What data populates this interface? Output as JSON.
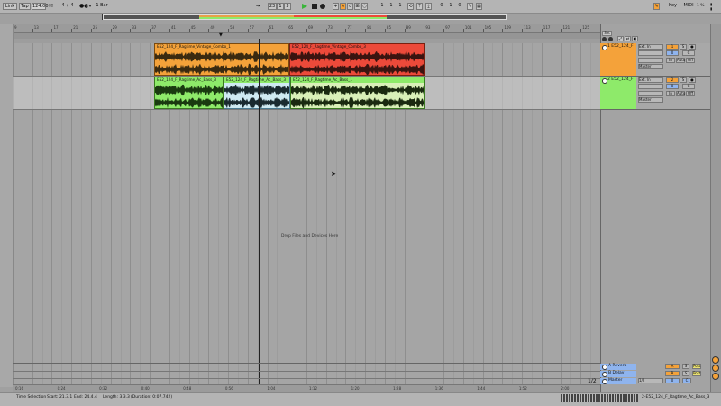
{
  "colors": {
    "track1": "#f4a23a",
    "track1_clip2": "#ec4a3a",
    "track2": "#8eea6a",
    "track2_sel": "#cfeaf2",
    "return_blue": "#8fb4ee",
    "arrangement_bg": "#a5a5a5",
    "transport_bg": "#b4b4b4"
  },
  "transport": {
    "link": "Link",
    "tap": "Tap",
    "tempo": "124.00",
    "sig_num": "4",
    "sig_den": "4",
    "metro": "1 Bar",
    "position": [
      "23",
      "1",
      "3"
    ],
    "loop_start": [
      "1",
      "1",
      "1"
    ],
    "loop_len": [
      "0",
      "1",
      "0"
    ],
    "key": "Key",
    "midi": "MIDI",
    "cpu": "1 %"
  },
  "ruler": {
    "bars": [
      "9",
      "13",
      "17",
      "21",
      "25",
      "29",
      "33",
      "37",
      "41",
      "45",
      "49",
      "53",
      "57",
      "61",
      "65",
      "69",
      "73",
      "77",
      "81",
      "85",
      "89",
      "93",
      "97",
      "101",
      "105",
      "109",
      "113",
      "117",
      "121",
      "125"
    ],
    "time_labels": [
      "0:16",
      "0:24",
      "0:32",
      "0:40",
      "0:48",
      "0:56",
      "1:04",
      "1:12",
      "1:20",
      "1:28",
      "1:36",
      "1:44",
      "1:52",
      "2:00"
    ],
    "set_label": "Set"
  },
  "tracks": [
    {
      "name": "1 E52_124_F",
      "input": "Ext. In",
      "output": "Master",
      "number": "1",
      "clips": [
        {
          "title": "E52_124_F_Ragtime_Vintage_Combo_1"
        },
        {
          "title": "E52_124_F_Ragtime_Vintage_Combo_3"
        }
      ]
    },
    {
      "name": "2 E52_124_F",
      "input": "Ext. In",
      "output": "Master",
      "number": "2",
      "clips": [
        {
          "title": "E52_124_F_Ragtime_Ac_Bass_3"
        },
        {
          "title": "E52_124_F_Ragtime_Ac_Bass_3"
        },
        {
          "title": "E52_124_F_Ragtime_Ac_Bass_1"
        }
      ]
    }
  ],
  "drop_text": "Drop Files and Devices Here",
  "returns": [
    {
      "name": "A Reverb",
      "letter": "A"
    },
    {
      "name": "B Delay",
      "letter": "B"
    },
    {
      "name": "Master",
      "letter": "0",
      "out": "1/2"
    }
  ],
  "zoom_fraction": "1/2",
  "status": {
    "selection": "Time Selection",
    "start": "Start: 21.3.1",
    "end": "End: 24.4.4",
    "length": "Length: 3.3.3",
    "duration": "(Duration: 0:07.742)",
    "clip_name": "2-E52_124_F_Ragtime_Ac_Bass_3"
  }
}
